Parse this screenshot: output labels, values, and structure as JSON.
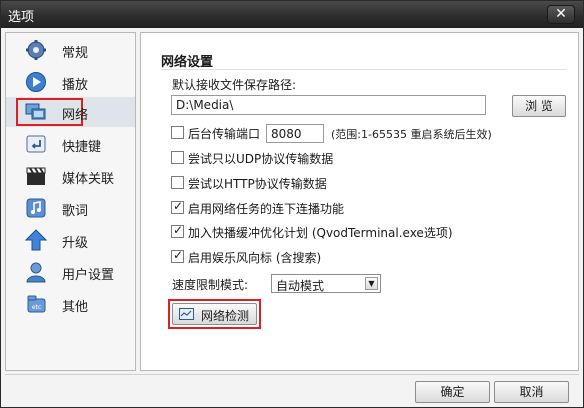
{
  "window": {
    "title": "选项",
    "close_icon": "close-icon"
  },
  "sidebar": {
    "items": [
      {
        "label": "常规",
        "icon": "gear-icon"
      },
      {
        "label": "播放",
        "icon": "play-icon"
      },
      {
        "label": "网络",
        "icon": "network-icon",
        "selected": true
      },
      {
        "label": "快捷键",
        "icon": "shortcut-key-icon"
      },
      {
        "label": "媒体关联",
        "icon": "clapperboard-icon"
      },
      {
        "label": "歌词",
        "icon": "music-note-icon"
      },
      {
        "label": "升级",
        "icon": "upgrade-arrow-icon"
      },
      {
        "label": "用户设置",
        "icon": "user-icon"
      },
      {
        "label": "其他",
        "icon": "etc-icon"
      }
    ]
  },
  "network": {
    "section_title": "网络设置",
    "save_path_label": "默认接收文件保存路径:",
    "save_path_value": "D:\\Media\\",
    "browse_label": "浏 览",
    "background_port_label": "后台传输端口",
    "background_port_checked": false,
    "port_value": "8080",
    "port_hint": "(范围:1-65535 重启系统后生效)",
    "udp_only_label": "尝试只以UDP协议传输数据",
    "udp_only_checked": false,
    "http_label": "尝试以HTTP协议传输数据",
    "http_checked": false,
    "resume_label": "启用网络任务的连下连播功能",
    "resume_checked": true,
    "optimize_label": "加入快播缓冲优化计划 (QvodTerminal.exe选项)",
    "optimize_checked": true,
    "tray_label": "启用娱乐风向标 (含搜索)",
    "tray_checked": true,
    "speed_mode_label": "速度限制模式:",
    "speed_mode_value": "自动模式",
    "net_check_label": "网络检测"
  },
  "footer": {
    "ok_label": "确定",
    "cancel_label": "取消"
  },
  "colors": {
    "highlight_border": "#e02020",
    "titlebar": "#2d2d2d",
    "selected_item": "#dfe4ea"
  }
}
